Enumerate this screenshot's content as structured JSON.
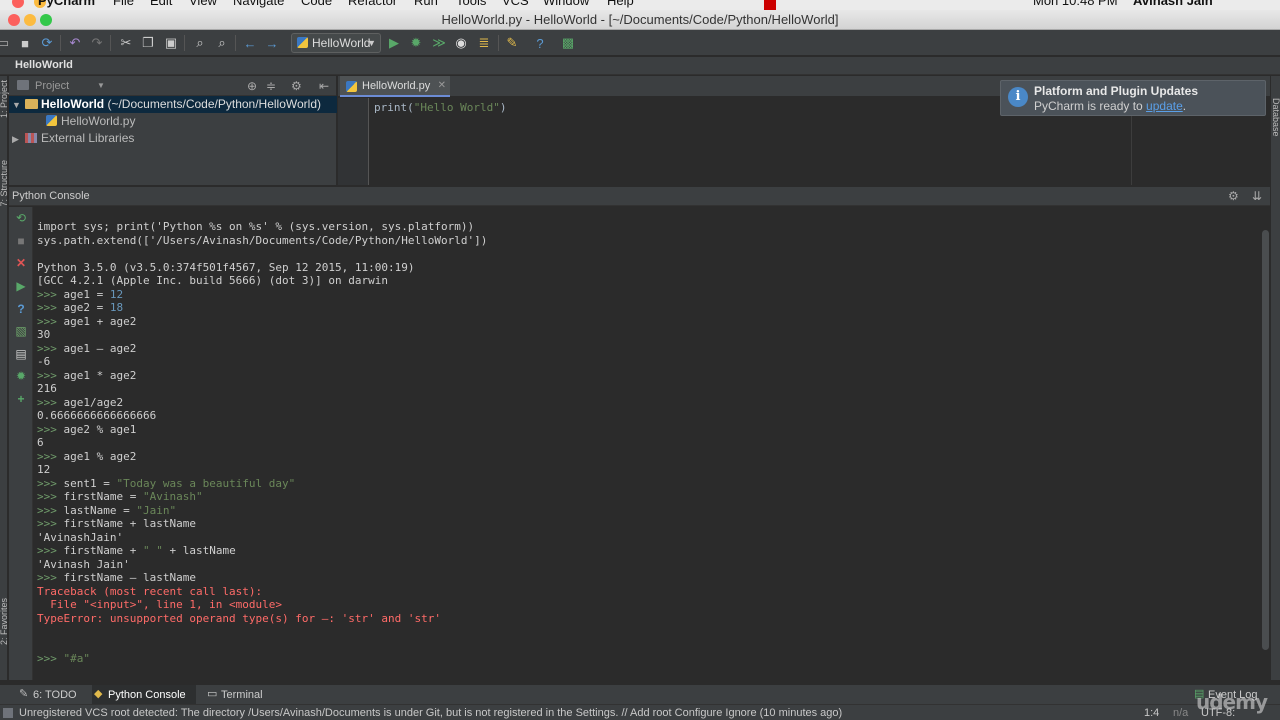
{
  "menubar": {
    "app": "PyCharm",
    "items": [
      "File",
      "Edit",
      "View",
      "Navigate",
      "Code",
      "Refactor",
      "Run",
      "Tools",
      "VCS",
      "Window",
      "Help"
    ],
    "clock": "Mon 10:48 PM",
    "user": "Avinash Jain"
  },
  "window": {
    "title": "HelloWorld.py - HelloWorld - [~/Documents/Code/Python/HelloWorld]"
  },
  "toolbar": {
    "run_config": "HelloWorld"
  },
  "navbar": {
    "crumb": "HelloWorld"
  },
  "stripes": {
    "left_top": "1: Project",
    "left_mid": "7: Structure",
    "left_bottom": "2: Favorites",
    "right": "Database"
  },
  "project": {
    "header": "Project",
    "root": "HelloWorld",
    "root_path": "(~/Documents/Code/Python/HelloWorld)",
    "file": "HelloWorld.py",
    "libs": "External Libraries"
  },
  "editor": {
    "tab": "HelloWorld.py",
    "code_fn": "print(",
    "code_str": "\"Hello World\"",
    "code_end": ")"
  },
  "notification": {
    "title": "Platform and Plugin Updates",
    "text": "PyCharm is ready to ",
    "link": "update",
    "end": "."
  },
  "console": {
    "title": "Python Console",
    "prompt": ">>>",
    "lines": {
      "l1": "import sys; print('Python %s on %s' % (sys.version, sys.platform))",
      "l2": "sys.path.extend(['/Users/Avinash/Documents/Code/Python/HelloWorld'])",
      "l3": "Python 3.5.0 (v3.5.0:374f501f4567, Sep 12 2015, 11:00:19)",
      "l4": "[GCC 4.2.1 (Apple Inc. build 5666) (dot 3)] on darwin",
      "c1": "age1 = ",
      "c1v": "12",
      "c2": "age2 = ",
      "c2v": "18",
      "c3": "age1 + age2",
      "o3": "30",
      "c4": "age1 – age2",
      "o4": "-6",
      "c5": "age1 * age2",
      "o5": "216",
      "c6": "age1/age2",
      "o6": "0.6666666666666666",
      "c7": "age2 % age1",
      "o7": "6",
      "c8": "age1 % age2",
      "o8": "12",
      "c9": "sent1 = ",
      "c9v": "\"Today was a beautiful day\"",
      "c10": "firstName = ",
      "c10v": "\"Avinash\"",
      "c11": "lastName = ",
      "c11v": "\"Jain\"",
      "c12": "firstName + lastName",
      "o12": "'AvinashJain'",
      "c13a": "firstName + ",
      "c13v": "\" \"",
      "c13b": " + lastName",
      "o13": "'Avinash Jain'",
      "c14": "firstName – lastName",
      "e1": "Traceback (most recent call last):",
      "e2": "  File \"<input>\", line 1, in <module>",
      "e3": "TypeError: unsupported operand type(s) for –: 'str' and 'str'",
      "input": "\"#a\""
    }
  },
  "bottom_tabs": {
    "todo": "6: TODO",
    "console": "Python Console",
    "terminal": "Terminal",
    "event_log": "Event Log"
  },
  "status": {
    "message": "Unregistered VCS root detected: The directory /Users/Avinash/Documents is under Git, but is not registered in the Settings. // Add root  Configure  Ignore (10 minutes ago)",
    "position": "1:4",
    "na": "n/a",
    "encoding": "UTF-8:"
  },
  "watermark": "udemy",
  "colors": {
    "prompt": "#6a8759",
    "number": "#6897bb",
    "string": "#6a8759",
    "error": "#ff6b68",
    "link": "#5a9fe8"
  }
}
